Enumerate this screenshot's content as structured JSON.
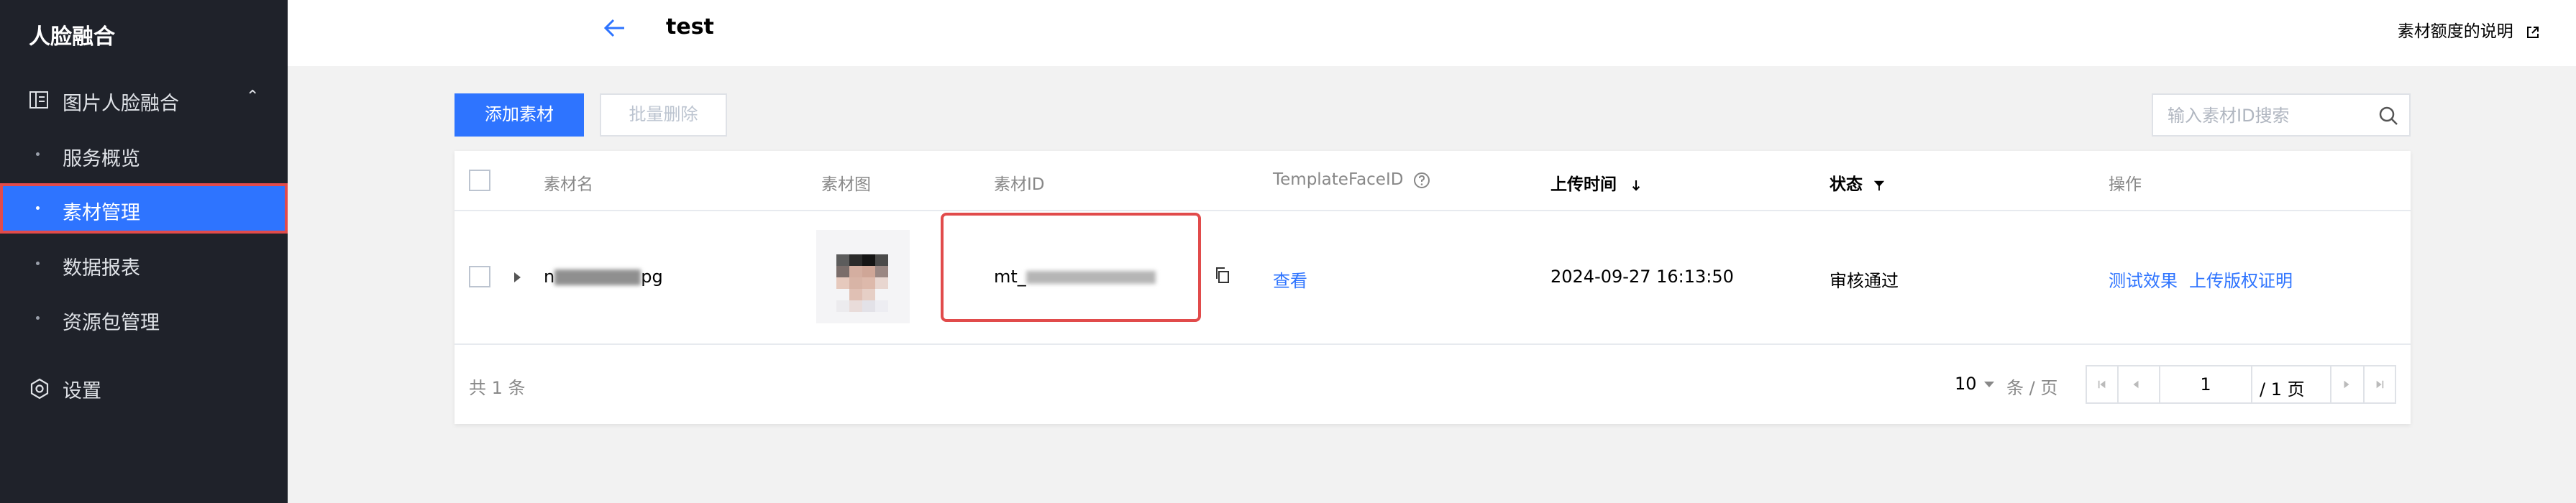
{
  "app": {
    "title": "人脸融合"
  },
  "sidebar": {
    "group": {
      "label": "图片人脸融合",
      "chevron": "⌃"
    },
    "items": [
      {
        "label": "服务概览"
      },
      {
        "label": "素材管理"
      },
      {
        "label": "数据报表"
      },
      {
        "label": "资源包管理"
      }
    ],
    "settings": {
      "label": "设置"
    }
  },
  "header": {
    "title": "test",
    "help_link": "素材额度的说明"
  },
  "toolbar": {
    "add_label": "添加素材",
    "batch_delete_label": "批量删除",
    "search_placeholder": "输入素材ID搜索"
  },
  "table": {
    "columns": {
      "name": "素材名",
      "image": "素材图",
      "id": "素材ID",
      "template": "TemplateFaceID",
      "upload_time": "上传时间",
      "status": "状态",
      "actions": "操作"
    },
    "rows": [
      {
        "name_start": "n",
        "name_end": "pg",
        "id_start": "mt_",
        "template_link": "查看",
        "upload_time": "2024-09-27 16:13:50",
        "status": "审核通过",
        "action_test": "测试效果",
        "action_upload": "上传版权证明"
      }
    ]
  },
  "pagination": {
    "total": "共 1 条",
    "page_size": "10",
    "per_page_unit": "条 / 页",
    "current_page": "1",
    "total_pages": "/ 1 页"
  },
  "colors": {
    "primary": "#2e74ff",
    "sidebar_bg": "#1f222a",
    "highlight": "#e14b4b"
  },
  "icons": {
    "group": "grid-icon",
    "settings": "gear-icon",
    "back": "arrow-left-icon",
    "external": "external-link-icon",
    "search": "search-icon",
    "sort": "arrow-down-icon",
    "filter": "filter-icon",
    "help": "help-circle-icon",
    "copy": "copy-icon"
  }
}
